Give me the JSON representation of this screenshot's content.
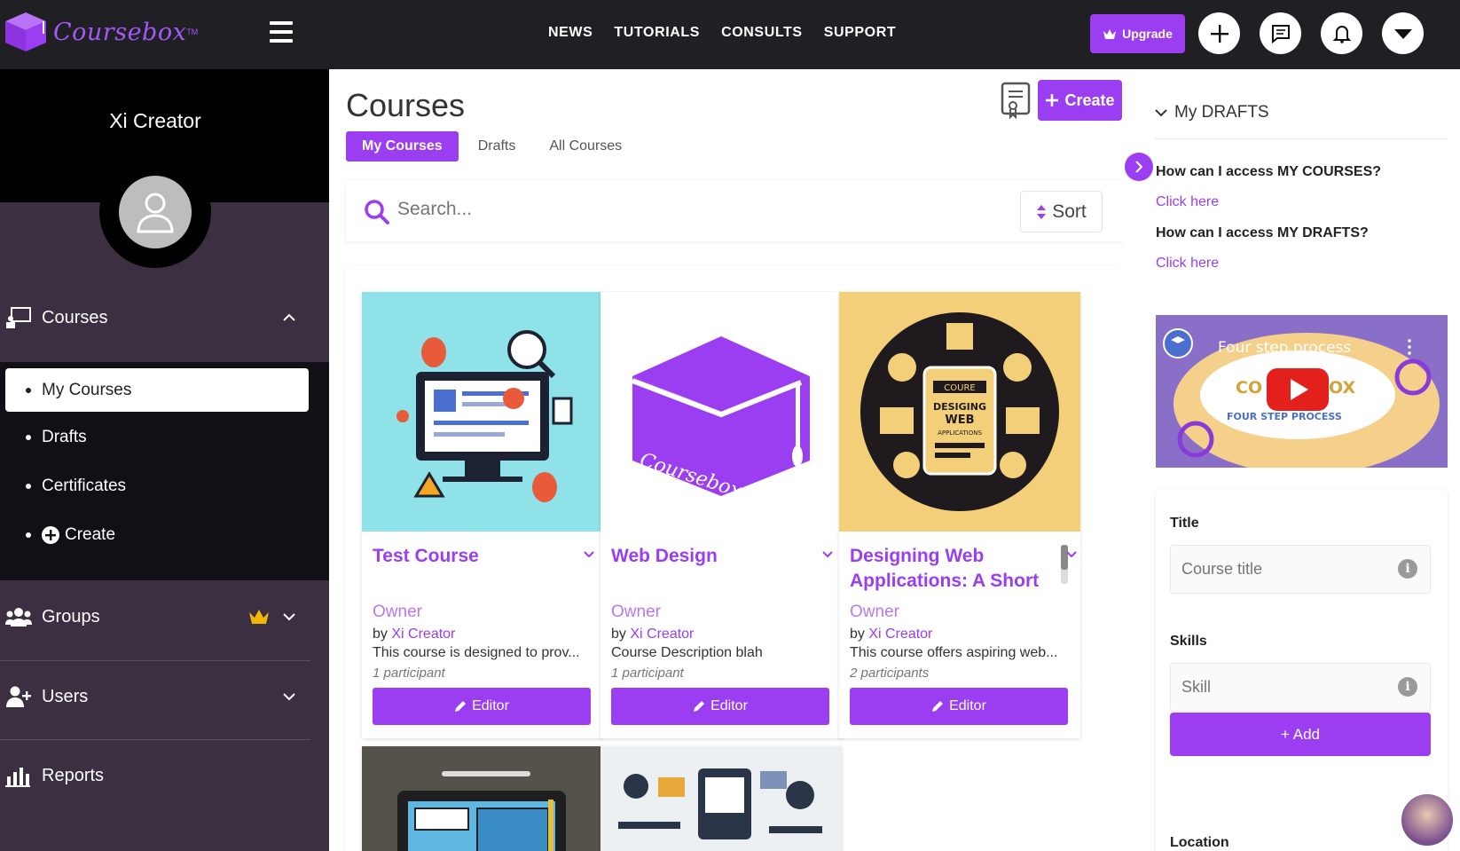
{
  "app": {
    "name": "Coursebox",
    "tm": "TM"
  },
  "topnav": {
    "items": [
      "NEWS",
      "TUTORIALS",
      "CONSULTS",
      "SUPPORT"
    ],
    "upgrade_label": "Upgrade"
  },
  "sidebar": {
    "profile_name": "Xi Creator",
    "courses_label": "Courses",
    "sub_items": [
      "My Courses",
      "Drafts",
      "Certificates",
      "Create"
    ],
    "groups_label": "Groups",
    "users_label": "Users",
    "reports_label": "Reports"
  },
  "main": {
    "title": "Courses",
    "create_label": "Create",
    "tabs": [
      "My Courses",
      "Drafts",
      "All Courses"
    ],
    "search_placeholder": "Search...",
    "sort_label": "Sort",
    "cards": [
      {
        "title": "Test Course",
        "owner": "Owner",
        "by": "by",
        "author": "Xi Creator",
        "desc": "This course is designed to prov...",
        "participants": "1 participant",
        "editor": "Editor"
      },
      {
        "title": "Web Design",
        "owner": "Owner",
        "by": "by",
        "author": "Xi Creator",
        "desc": "Course Description blah",
        "participants": "1 participant",
        "editor": "Editor"
      },
      {
        "title": "Designing Web Applications: A Short",
        "owner": "Owner",
        "by": "by",
        "author": "Xi Creator",
        "desc": "This course offers aspiring web...",
        "participants": "2 participants",
        "editor": "Editor"
      }
    ],
    "card3_img_text": {
      "course": "COURE",
      "l1": "DESIGING",
      "l2": "WEB",
      "l3": "APPLICATIONS"
    },
    "card2_img_text": "Coursebox"
  },
  "right": {
    "drafts_heading": "My DRAFTS",
    "faq": [
      {
        "q": "How can I access MY COURSES?",
        "a": "Click here"
      },
      {
        "q": "How can I access MY DRAFTS?",
        "a": "Click here"
      }
    ],
    "video_title": "Four step process",
    "video_sub": "FOUR STEP PROCESS",
    "form": {
      "title_label": "Title",
      "title_placeholder": "Course title",
      "skills_label": "Skills",
      "skills_placeholder": "Skill",
      "add_label": "+ Add",
      "location_label": "Location"
    }
  },
  "colors": {
    "accent": "#9b3df0",
    "topbar": "#1f1f24",
    "sidebar": "#120f16",
    "sidebar_alt": "#3b2f41"
  }
}
